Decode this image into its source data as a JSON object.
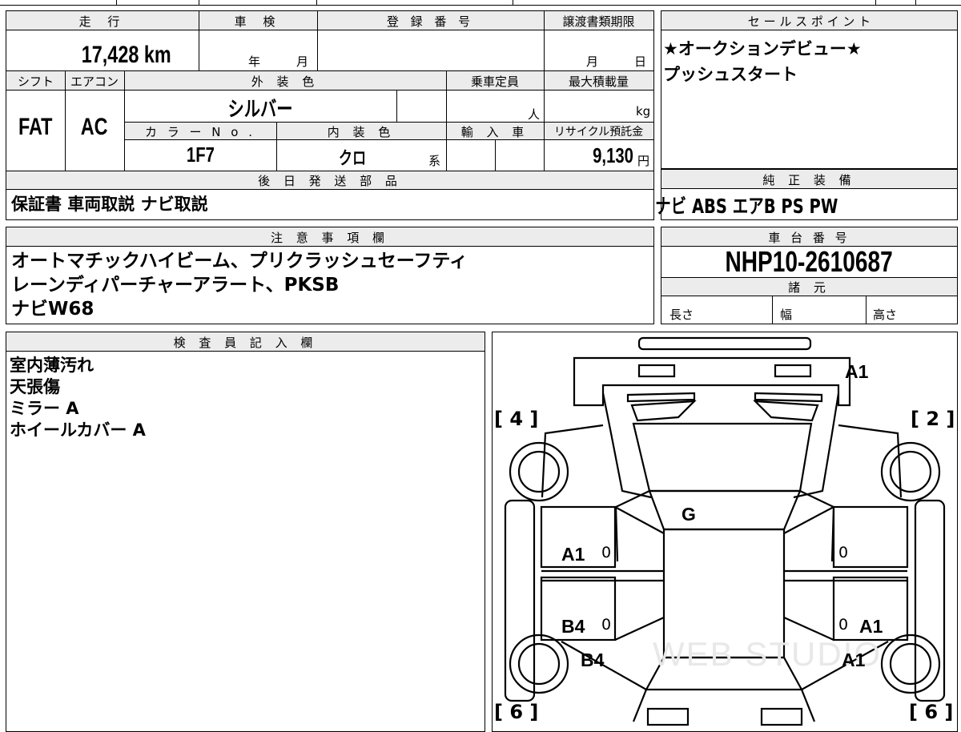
{
  "top_strip": [
    "",
    "",
    "",
    "",
    ""
  ],
  "info": {
    "mileage": {
      "header": "走 行",
      "value": "17,428 km"
    },
    "inspection": {
      "header": "車 検",
      "year_unit": "年",
      "month_unit": "月"
    },
    "registration": {
      "header": "登 録 番 号"
    },
    "transfer": {
      "header": "譲渡書類期限",
      "month_unit": "月",
      "day_unit": "日"
    },
    "shift": {
      "header": "シフト",
      "value": "FAT"
    },
    "aircon": {
      "header": "エアコン",
      "value": "AC"
    },
    "exterior": {
      "header": "外 装 色",
      "value": "シルバー"
    },
    "capacity": {
      "header": "乗車定員",
      "unit": "人"
    },
    "max_load": {
      "header": "最大積載量",
      "unit": "kg"
    },
    "color_no": {
      "header": "カ ラ ー N o .",
      "value": "1F7"
    },
    "interior": {
      "header": "内 装 色",
      "value": "クロ",
      "suffix": "系"
    },
    "import": {
      "header": "輸 入 車"
    },
    "recycle": {
      "header": "リサイクル預託金",
      "value": "9,130",
      "unit": "円"
    },
    "later_parts": {
      "header": "後 日 発 送 部 品",
      "value": "保証書 車両取説 ナビ取説"
    }
  },
  "sales_point": {
    "header": "セ ー ル ス ポ イ ン ト",
    "lines": [
      "★オークションデビュー★",
      "プッシュスタート"
    ]
  },
  "equipment": {
    "header": "純 正 装 備",
    "value": "ナビ ABS エアB PS PW"
  },
  "notes": {
    "header": "注 意 事 項 欄",
    "lines": [
      "オートマチックハイビーム、プリクラッシュセーフティ",
      "レーンディパーチャーアラート、PKSB",
      "ナビW68"
    ]
  },
  "chassis": {
    "header": "車 台 番 号",
    "value": "NHP10-2610687"
  },
  "specs": {
    "header": "諸 元",
    "length": "長さ",
    "width": "幅",
    "height": "高さ"
  },
  "inspector": {
    "header": "検 査 員 記 入 欄",
    "lines": [
      "室内薄汚れ",
      "天張傷",
      "ミラー A",
      "ホイールカバー A"
    ]
  },
  "diagram": {
    "bracket_tl": "[ 4 ]",
    "bracket_tr": "[ 2 ]",
    "bracket_bl": "[ 6 ]",
    "bracket_br": "[ 6 ]",
    "mark_front": "A1",
    "mark_glass": "G",
    "mark_left_front": "A1",
    "mark_left_rear": "B4",
    "mark_left_rear2": "B4",
    "mark_right_rear": "A1",
    "mark_right_rear2": "A1",
    "zero_lf": "0",
    "zero_lr": "0",
    "zero_rf": "0",
    "zero_rr": "0",
    "watermark": "WEB STUDIO"
  }
}
